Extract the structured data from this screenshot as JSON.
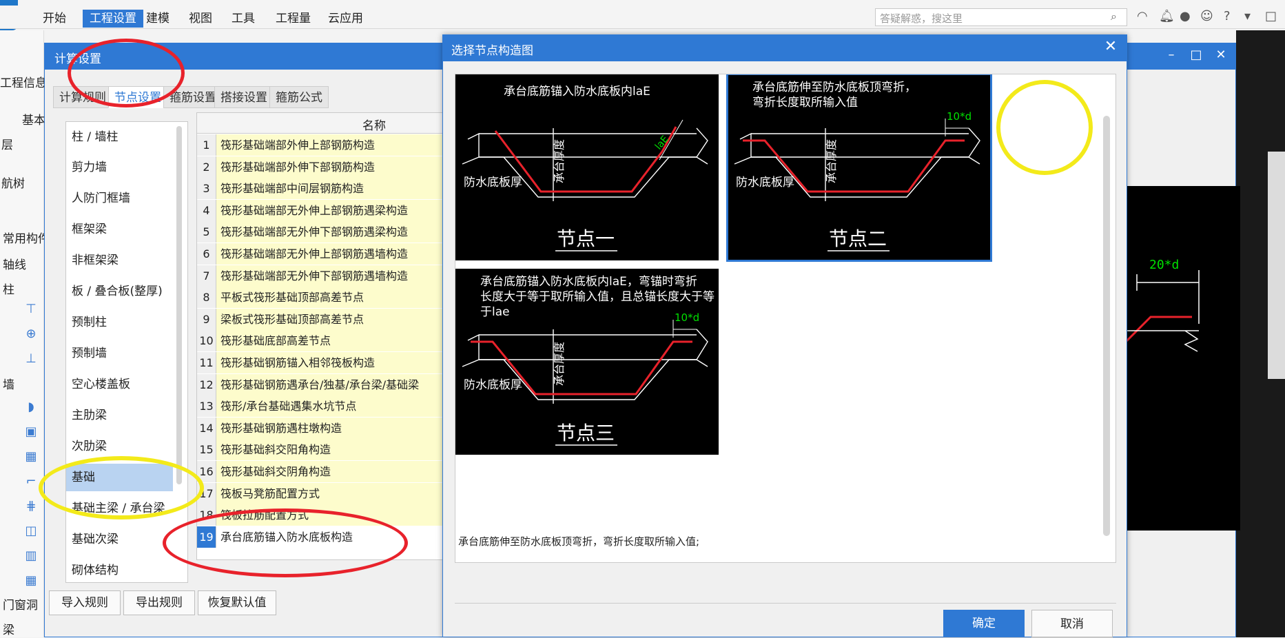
{
  "menubar": {
    "items": [
      "开始",
      "工程设置",
      "建模",
      "视图",
      "工具",
      "工程量",
      "云应用"
    ],
    "active_index": 1,
    "search_placeholder": "答疑解惑，搜这里"
  },
  "left_panel": {
    "labels": [
      "工程信息",
      "基本",
      "层",
      "航树",
      "常用构件",
      "轴线",
      "柱",
      "墙",
      "门窗洞",
      "梁"
    ]
  },
  "calc_dialog": {
    "title": "计算设置",
    "tabs": [
      "计算规则",
      "节点设置",
      "箍筋设置",
      "搭接设置",
      "箍筋公式"
    ],
    "active_tab": 1,
    "categories": [
      "柱 / 墙柱",
      "剪力墙",
      "人防门框墙",
      "框架梁",
      "非框架梁",
      "板 / 叠合板(整厚)",
      "预制柱",
      "预制墙",
      "空心楼盖板",
      "主肋梁",
      "次肋梁",
      "基础",
      "基础主梁 / 承台梁",
      "基础次梁",
      "砌体结构"
    ],
    "selected_category": 11,
    "table_header": "名称",
    "rules": [
      {
        "num": "1",
        "name": "筏形基础端部外伸上部钢筋构造"
      },
      {
        "num": "2",
        "name": "筏形基础端部外伸下部钢筋构造"
      },
      {
        "num": "3",
        "name": "筏形基础端部中间层钢筋构造"
      },
      {
        "num": "4",
        "name": "筏形基础端部无外伸上部钢筋遇梁构造"
      },
      {
        "num": "5",
        "name": "筏形基础端部无外伸下部钢筋遇梁构造"
      },
      {
        "num": "6",
        "name": "筏形基础端部无外伸上部钢筋遇墙构造"
      },
      {
        "num": "7",
        "name": "筏形基础端部无外伸下部钢筋遇墙构造"
      },
      {
        "num": "8",
        "name": "平板式筏形基础顶部高差节点"
      },
      {
        "num": "9",
        "name": "梁板式筏形基础顶部高差节点"
      },
      {
        "num": "10",
        "name": "筏形基础底部高差节点"
      },
      {
        "num": "11",
        "name": "筏形基础钢筋锚入相邻筏板构造"
      },
      {
        "num": "12",
        "name": "筏形基础钢筋遇承台/独基/承台梁/基础梁"
      },
      {
        "num": "13",
        "name": "筏形/承台基础遇集水坑节点"
      },
      {
        "num": "14",
        "name": "筏形基础钢筋遇柱墩构造"
      },
      {
        "num": "15",
        "name": "筏形基础斜交阳角构造"
      },
      {
        "num": "16",
        "name": "筏形基础斜交阴角构造"
      },
      {
        "num": "17",
        "name": "筏板马凳筋配置方式"
      },
      {
        "num": "18",
        "name": "筏板拉筋配置方式"
      },
      {
        "num": "19",
        "name": "承台底筋锚入防水底板构造"
      }
    ],
    "selected_rule": 18,
    "buttons": {
      "import": "导入规则",
      "export": "导出规则",
      "restore": "恢复默认值"
    }
  },
  "node_dialog": {
    "title": "选择节点构造图",
    "nodes": [
      {
        "name": "节点一",
        "caption": "承台底筋锚入防水底板内laE",
        "side_label": "防水底板厚",
        "vertical_label": "承台厚度",
        "dim_label": "laE"
      },
      {
        "name": "节点二",
        "caption": "承台底筋伸至防水底板顶弯折，弯折长度取所输入值",
        "side_label": "防水底板厚",
        "vertical_label": "承台厚度",
        "dim_label": "10*d"
      },
      {
        "name": "节点三",
        "caption": "承台底筋锚入防水底板内laE，弯锚时弯折长度大于等于取所输入值，且总锚长度大于等于lae",
        "side_label": "防水底板厚",
        "vertical_label": "承台厚度",
        "dim_label": "10*d"
      }
    ],
    "selected_node": 1,
    "description": "承台底筋伸至防水底板顶弯折，弯折长度取所输入值;",
    "ok": "确定",
    "cancel": "取消"
  },
  "background_cad": {
    "dim_label": "20*d"
  },
  "colors": {
    "accent": "#2f79d4",
    "rebar": "#e8222b",
    "dimension": "#00e000",
    "annotation_red": "#e8222b",
    "annotation_yellow": "#f3ea1a"
  }
}
